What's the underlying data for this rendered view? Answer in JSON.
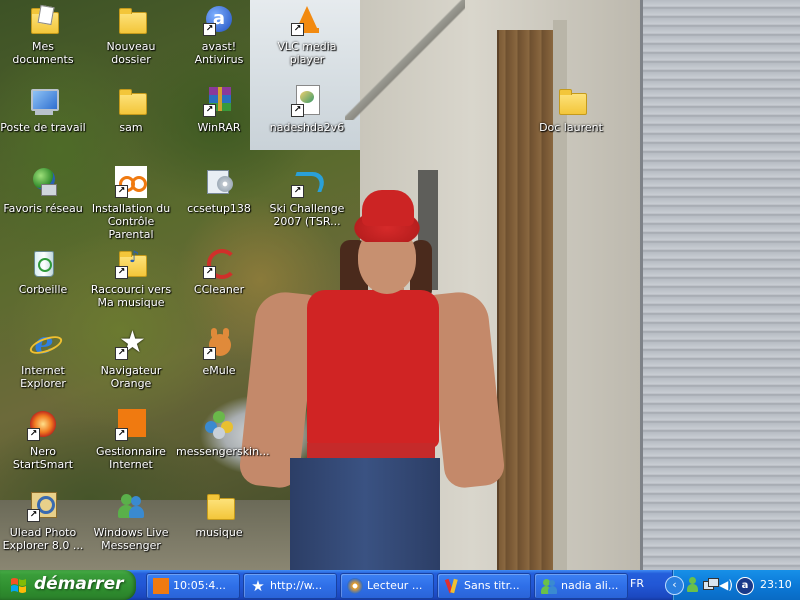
{
  "desktop": {
    "icons": [
      {
        "label": "Mes documents",
        "icon": "my-documents-icon"
      },
      {
        "label": "Nouveau dossier",
        "icon": "folder-icon"
      },
      {
        "label": "avast! Antivirus",
        "icon": "avast-icon"
      },
      {
        "label": "VLC media player",
        "icon": "vlc-icon"
      },
      {
        "label": "Poste de travail",
        "icon": "my-computer-icon"
      },
      {
        "label": "sam",
        "icon": "folder-icon"
      },
      {
        "label": "WinRAR",
        "icon": "winrar-icon"
      },
      {
        "label": "nadeshda2v6",
        "icon": "image-file-icon"
      },
      {
        "label": "Doc laurent",
        "icon": "folder-icon"
      },
      {
        "label": "Favoris réseau",
        "icon": "network-places-icon"
      },
      {
        "label": "Installation du Contrôle Parental",
        "icon": "orange-parental-control-icon"
      },
      {
        "label": "ccsetup138",
        "icon": "installer-icon"
      },
      {
        "label": "Ski Challenge 2007 (TSR...",
        "icon": "ski-challenge-icon"
      },
      {
        "label": "Corbeille",
        "icon": "recycle-bin-icon"
      },
      {
        "label": "Raccourci vers Ma musique",
        "icon": "music-folder-icon"
      },
      {
        "label": "CCleaner",
        "icon": "ccleaner-icon"
      },
      {
        "label": "Internet Explorer",
        "icon": "internet-explorer-icon"
      },
      {
        "label": "Navigateur Orange",
        "icon": "orange-browser-icon"
      },
      {
        "label": "eMule",
        "icon": "emule-icon"
      },
      {
        "label": "Nero StartSmart",
        "icon": "nero-icon"
      },
      {
        "label": "Gestionnaire Internet",
        "icon": "orange-manager-icon"
      },
      {
        "label": "messengerskin...",
        "icon": "messenger-skin-icon"
      },
      {
        "label": "Ulead Photo Explorer 8.0 ...",
        "icon": "ulead-icon"
      },
      {
        "label": "Windows Live Messenger",
        "icon": "messenger-icon"
      },
      {
        "label": "musique",
        "icon": "folder-icon"
      }
    ]
  },
  "taskbar": {
    "start_label": "démarrer",
    "tasks": [
      {
        "label": "10:05:4...",
        "icon": "orange-icon"
      },
      {
        "label": "http://w...",
        "icon": "star-browser-icon"
      },
      {
        "label": "Lecteur ...",
        "icon": "media-player-icon"
      },
      {
        "label": "Sans titr...",
        "icon": "paint-icon"
      },
      {
        "label": "nadia ali...",
        "icon": "messenger-icon"
      }
    ],
    "language": "FR",
    "clock": "23:10",
    "tray_icons": [
      "show-hidden-icon",
      "messenger-status-icon",
      "network-icon",
      "volume-icon",
      "security-icon",
      "update-icon"
    ]
  }
}
